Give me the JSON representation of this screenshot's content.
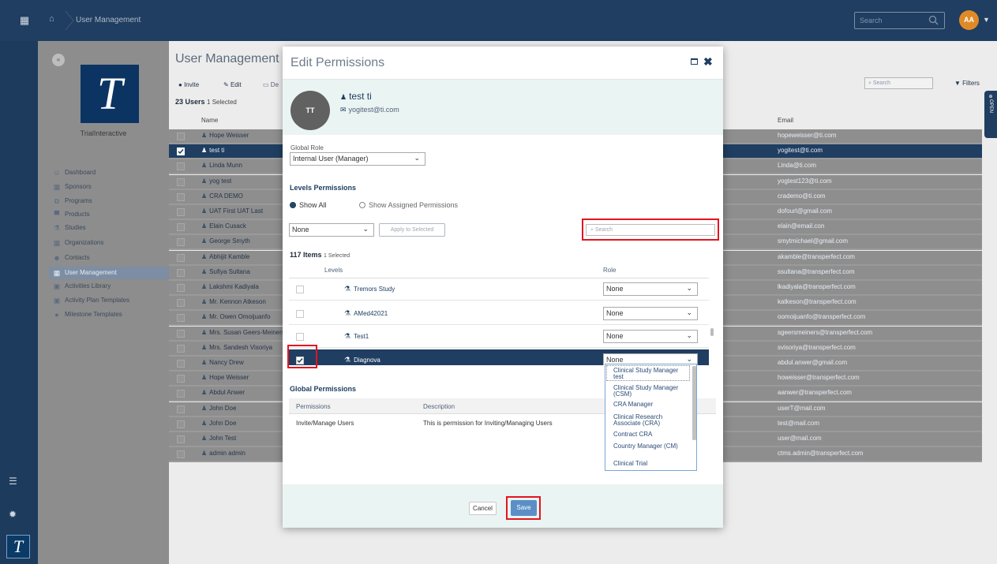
{
  "topbar": {
    "breadcrumb": "User Management",
    "search_placeholder": "Search",
    "avatar_initials": "AA"
  },
  "sidebar": {
    "org_name": "TrialInteractive",
    "items": [
      {
        "label": "Dashboard",
        "icon": "dashboard-icon",
        "glyph": "☺"
      },
      {
        "label": "Sponsors",
        "icon": "building-icon",
        "glyph": "▦"
      },
      {
        "label": "Programs",
        "icon": "programs-icon",
        "glyph": "⧉"
      },
      {
        "label": "Products",
        "icon": "products-icon",
        "glyph": "▀"
      },
      {
        "label": "Studies",
        "icon": "flask-icon",
        "glyph": "⚗"
      },
      {
        "label": "Organizations",
        "icon": "organization-icon",
        "glyph": "▦"
      },
      {
        "label": "Contacts",
        "icon": "contacts-icon",
        "glyph": "☻"
      },
      {
        "label": "User Management",
        "icon": "grid-icon",
        "glyph": "▦",
        "active": true
      },
      {
        "label": "Activities Library",
        "icon": "calendar-icon",
        "glyph": "▣"
      },
      {
        "label": "Activity Plan Templates",
        "icon": "template-icon",
        "glyph": "▣"
      },
      {
        "label": "Milestone Templates",
        "icon": "marker-icon",
        "glyph": "●"
      }
    ]
  },
  "page": {
    "title": "User Management",
    "toolbar": {
      "invite": "Invite",
      "edit": "Edit",
      "de": "De"
    },
    "count_label": "23 Users",
    "count_selected": "1  Selected",
    "search_placeholder": "Search",
    "filters": "Filters",
    "side_tab": "OPEN",
    "columns": {
      "name": "Name",
      "email": "Email"
    },
    "rows": [
      {
        "name": "Hope Weisser",
        "email": "hopeweisser@ti.com"
      },
      {
        "name": "test ti",
        "email": "yogitest@ti.com",
        "selected": true
      },
      {
        "name": "Linda Munn",
        "email": "Linda@ti.com"
      },
      {
        "name": "yog test",
        "email": "yogtest123@ti.com"
      },
      {
        "name": "CRA DEMO",
        "email": "crademo@ti.com"
      },
      {
        "name": "UAT First UAT Last",
        "email": "dofourl@gmail.com"
      },
      {
        "name": "Elain Cusack",
        "email": "elain@email.con"
      },
      {
        "name": "George Smyth",
        "email": "smytmichael@gmail.com"
      },
      {
        "name": "Abhijit Kamble",
        "email": "akamble@transperfect.com"
      },
      {
        "name": "Sufiya Sultana",
        "email": "ssultana@transperfect.com"
      },
      {
        "name": "Lakshmi Kadiyala",
        "email": "lkadiyala@transperfect.com"
      },
      {
        "name": "Mr. Kennon Atkeson",
        "email": "katkeson@transperfect.com"
      },
      {
        "name": "Mr. Owen Omoijuanfo",
        "email": "oomoijuanfo@transperfect.com"
      },
      {
        "name": "Mrs. Susan Geers-Meiners",
        "email": "sgeersmeiners@transperfect.com"
      },
      {
        "name": "Mrs. Sandesh Visoriya",
        "email": "svisoriya@transperfect.com"
      },
      {
        "name": "Nancy Drew",
        "email": "abdul.anwer@gmail.com"
      },
      {
        "name": "Hope Weisser",
        "email": "howeisser@transperfect.com"
      },
      {
        "name": "Abdul Anwer",
        "email": "aanwer@transperfect.com"
      },
      {
        "name": "John Doe",
        "email": "userT@mail.com"
      },
      {
        "name": "John Doe",
        "email": "test@mail.com"
      },
      {
        "name": "John Test",
        "email": "user@mail.com"
      },
      {
        "name": "admin admin",
        "email": "ctms.admin@transperfect.com"
      }
    ]
  },
  "modal": {
    "title": "Edit Permissions",
    "user": {
      "initials": "TT",
      "name": "test ti",
      "email": "yogitest@ti.com"
    },
    "global_role_label": "Global Role",
    "global_role_value": "Internal User (Manager)",
    "levels_heading": "Levels Permissions",
    "radio_show_all": "Show All",
    "radio_show_assigned": "Show Assigned Permissions",
    "bulk_role_value": "None",
    "apply_button": "Apply to Selected",
    "search_placeholder": "Search",
    "items_count": "117 Items",
    "items_selected": "1  Selected",
    "levels_col": "Levels",
    "role_col": "Role",
    "level_rows": [
      {
        "name": "Tremors Study",
        "role": "None"
      },
      {
        "name": "AMed42021",
        "role": "None"
      },
      {
        "name": "Test1",
        "role": "None"
      },
      {
        "name": "Diagnova",
        "role": "None",
        "selected": true
      }
    ],
    "role_options": [
      "Clinical Study Manager test",
      "Clinical Study Manager (CSM)",
      "CRA Manager",
      "Clinical Research Associate (CRA)",
      "Contract CRA",
      "Country Manager (CM)",
      "Clinical Trial"
    ],
    "global_perms_heading": "Global Permissions",
    "global_perms_cols": {
      "permissions": "Permissions",
      "description": "Description"
    },
    "global_perms_row": {
      "permission": "Invite/Manage Users",
      "description": "This is permission for Inviting/Managing Users"
    },
    "cancel": "Cancel",
    "save": "Save"
  },
  "colors": {
    "navy": "#1f3e61",
    "highlight": "#e3151f",
    "save": "#5b8fc6",
    "avatar": "#e08a27"
  }
}
